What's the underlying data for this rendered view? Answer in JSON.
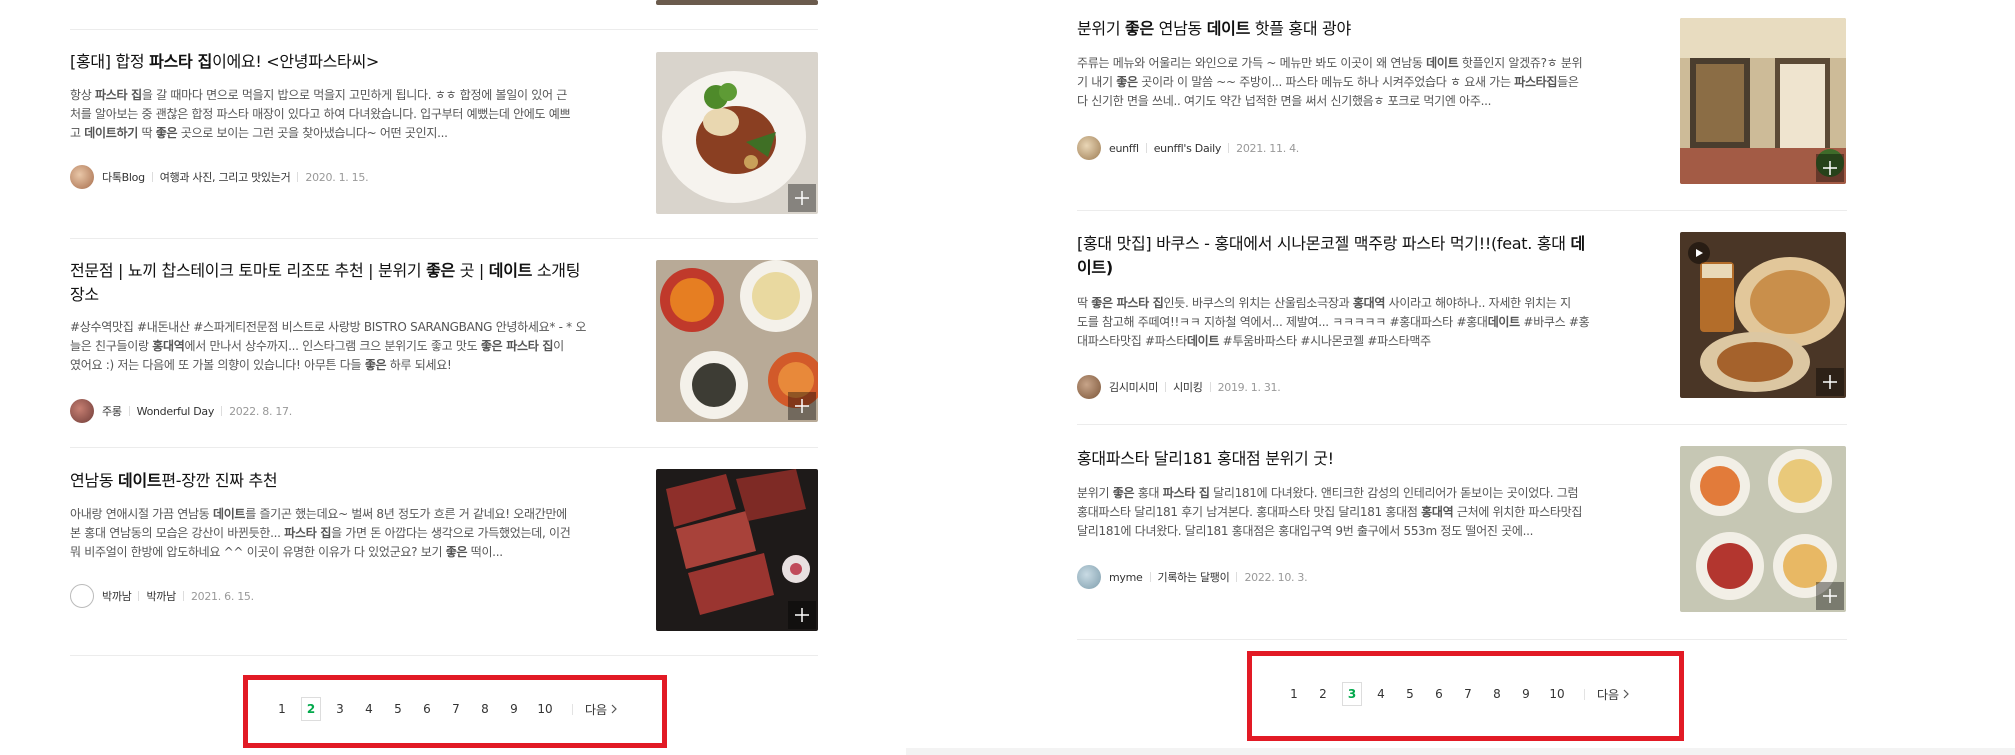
{
  "colors": {
    "highlight_box": "#e21a25",
    "active_page": "#03a94c",
    "divider": "#ececec"
  },
  "left": {
    "results": [
      {
        "title_parts": [
          "[홍대] 합정 ",
          "파스타 집",
          "이에요! <안녕파스타씨>"
        ],
        "snippet_lines": [
          [
            "항상 ",
            "파스타 집",
            "을 갈 때마다 면으로 먹을지 밥으로 먹을지 고민하게 됩니다. ㅎㅎ 합정에 볼일이 있어 근"
          ],
          [
            "처를 알아보는 중 괜찮은 합정 파스타 매장이 있다고 하여 다녀왔습니다. 입구부터 예뻤는데 안에도 예쁘"
          ],
          [
            "고 ",
            "데이트하기",
            " 딱 ",
            "좋은",
            " 곳으로 보이는 그런 곳을 찾아냈습니다~ 어떤 곳인지..."
          ]
        ],
        "author": "다톡Blog",
        "blog": "여행과 사진, 그리고 맛있는거",
        "date": "2020. 1. 15.",
        "thumb_icon": "pasta-plate-image"
      },
      {
        "title_parts": [
          "전문점 | 뇨끼 찹스테이크 토마토 리조또 추천 | 분위기 ",
          "좋은",
          " 곳 | ",
          "데이트",
          " 소개팅"
        ],
        "title_line2": "장소",
        "snippet_lines": [
          [
            "#상수역맛집 #내돈내산 #스파게티전문점 비스트로 사랑방 BISTRO SARANGBANG 안녕하세요* - * 오"
          ],
          [
            "늘은 친구들이랑 ",
            "홍대역",
            "에서 만나서 상수까지... 인스타그램 크으 분위기도 좋고 맛도 ",
            "좋은 파스타 집",
            "이"
          ],
          [
            "였어요 :) 저는 다음에 또 가볼 의향이 있습니다! 아무튼 다들 ",
            "좋은",
            " 하루 되세요!"
          ]
        ],
        "author": "주롱",
        "blog": "Wonderful Day",
        "date": "2022. 8. 17.",
        "thumb_icon": "dishes-table-image"
      },
      {
        "title_parts": [
          "연남동 ",
          "데이트",
          "편-장깐 진짜 추천"
        ],
        "snippet_lines": [
          [
            "아내랑 연애시절 가끔 연남동 ",
            "데이트",
            "를 즐기곤 했는데요~ 벌써 8년 정도가 흐른 거 같네요! 오래간만에"
          ],
          [
            "본 홍대 연남동의 모습은 강산이 바뀐듯한... ",
            "파스타 집",
            "을 가면 돈 아깝다는 생각으로 가득했었는데, 이건"
          ],
          [
            "뭐 비주얼이 한방에 압도하네요 ^^ 이곳이 유명한 이유가 다 있었군요? 보기 ",
            "좋은",
            " 떡이..."
          ]
        ],
        "author": "박까남",
        "blog": "박까남",
        "date": "2021. 6. 15.",
        "thumb_icon": "steak-image"
      }
    ],
    "pagination": {
      "pages": [
        "1",
        "2",
        "3",
        "4",
        "5",
        "6",
        "7",
        "8",
        "9",
        "10"
      ],
      "active": "2",
      "next_label": "다음"
    }
  },
  "right": {
    "results": [
      {
        "title_parts": [
          "분위기 ",
          "좋은",
          " 연남동 ",
          "데이트",
          " 핫플 홍대 광야"
        ],
        "snippet_lines": [
          [
            "주류는 메뉴와 어울리는 와인으로 가득 ~ 메뉴만 봐도 이곳이 왜 연남동 ",
            "데이트",
            " 핫플인지 알겠쥬?ㅎ 분위"
          ],
          [
            "기 내기 ",
            "좋은",
            " 곳이라 이 말씀 ~~ 주방이... 파스타 메뉴도 하나 시켜주었습다 ㅎ 요새 가는 ",
            "파스타집",
            "들은"
          ],
          [
            "다 신기한 면을 쓰네.. 여기도 약간 넙적한 면을 써서 신기했음ㅎ 포크로 먹기엔 아주..."
          ]
        ],
        "author": "eunffl",
        "blog": "eunffl's Daily",
        "date": "2021. 11. 4.",
        "thumb_icon": "restaurant-facade-image"
      },
      {
        "title_parts": [
          "[홍대 맛집] 바쿠스 - 홍대에서 시나몬코젤 맥주랑 파스타 먹기!!(feat. 홍대 ",
          "데"
        ],
        "title_line2": "이트)",
        "snippet_lines": [
          [
            "딱 ",
            "좋은 파스타 집",
            "인듯. 바쿠스의 위치는 산울림소극장과 ",
            "홍대역",
            " 사이라고 해야하나.. 자세한 위치는 지"
          ],
          [
            "도를 참고해 주떼여!!ㅋㅋ 지하철 역에서... 제발여... ㅋㅋㅋㅋㅋ #홍대파스타 #홍대",
            "데이트",
            " #바쿠스 #홍"
          ],
          [
            "대파스타맛집 #파스타",
            "데이트",
            " #투움바파스타 #시나몬코젤 #파스타맥주"
          ]
        ],
        "author": "김시미시미",
        "blog": "시미킹",
        "date": "2019. 1. 31.",
        "thumb_icon": "pasta-beer-video-image"
      },
      {
        "title_parts": [
          "홍대파스타 달리181 홍대점 분위기 굿!"
        ],
        "snippet_lines": [
          [
            "분위기 ",
            "좋은",
            " 홍대 ",
            "파스타 집",
            " 달리181에 다녀왔다. 앤티크한 감성의 인테리어가 돋보이는 곳이었다. 그럼"
          ],
          [
            "홍대파스타 달리181 후기 남겨본다. 홍대파스타 맛집 달리181 홍대점 ",
            "홍대역",
            " 근처에 위치한 파스타맛집"
          ],
          [
            "달리181에 다녀왔다. 달리181 홍대점은 홍대입구역 9번 출구에서 553m 정도 떨어진 곳에..."
          ]
        ],
        "author": "myme",
        "blog": "기록하는 달팽이",
        "date": "2022. 10. 3.",
        "thumb_icon": "pasta-spread-image"
      }
    ],
    "pagination": {
      "pages": [
        "1",
        "2",
        "3",
        "4",
        "5",
        "6",
        "7",
        "8",
        "9",
        "10"
      ],
      "active": "3",
      "next_label": "다음"
    }
  }
}
